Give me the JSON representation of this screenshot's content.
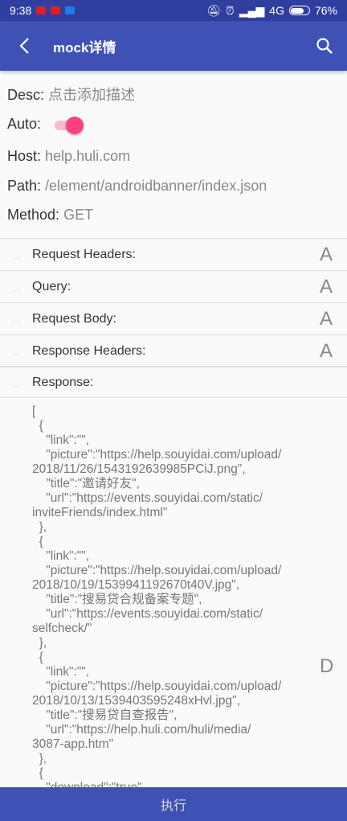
{
  "status_bar": {
    "time": "9:38",
    "network": "4G",
    "battery": "76%",
    "battery_level": 76
  },
  "toolbar": {
    "title": "mock详情",
    "back_icon": "arrow-back-icon",
    "search_icon": "search-icon"
  },
  "fields": {
    "desc": {
      "label": "Desc:",
      "value": "点击添加描述"
    },
    "auto": {
      "label": "Auto:",
      "on": true,
      "color": "#ff4081"
    },
    "host": {
      "label": "Host:",
      "value": "help.huli.com"
    },
    "path": {
      "label": "Path:",
      "value": "/element/androidbanner/index.json"
    },
    "method": {
      "label": "Method:",
      "value": "GET"
    }
  },
  "sections": [
    {
      "label": "Request Headers:",
      "badge": "A"
    },
    {
      "label": "Query:",
      "badge": "A"
    },
    {
      "label": "Request Body:",
      "badge": "A"
    },
    {
      "label": "Response Headers:",
      "badge": "A"
    },
    {
      "label": "Response:",
      "badge": ""
    }
  ],
  "response_badge": "D",
  "response_lines": [
    "[",
    "  {",
    "    \"link\":\"\",",
    "    \"picture\":\"https://help.souyidai.com/upload/",
    "2018/11/26/1543192639985PCiJ.png\",",
    "    \"title\":\"邀请好友\",",
    "    \"url\":\"https://events.souyidai.com/static/",
    "inviteFriends/index.html\"",
    "  },",
    "  {",
    "    \"link\":\"\",",
    "    \"picture\":\"https://help.souyidai.com/upload/",
    "2018/10/19/1539941192670t40V.jpg\",",
    "    \"title\":\"搜易贷合规备案专题\",",
    "    \"url\":\"https://events.souyidai.com/static/",
    "selfcheck/\"",
    "  },",
    "  {",
    "    \"link\":\"\",",
    "    \"picture\":\"https://help.souyidai.com/upload/",
    "2018/10/13/1539403595248xHvl.jpg\",",
    "    \"title\":\"搜易贷自查报告\",",
    "    \"url\":\"https://help.huli.com/huli/media/",
    "3087-app.htm\"",
    "  },",
    "  {",
    "    \"download\":\"true\","
  ],
  "execute_button": "执行",
  "colors": {
    "primary": "#3F51B5",
    "primary_dark": "#303F9F",
    "accent": "#ff4081"
  }
}
